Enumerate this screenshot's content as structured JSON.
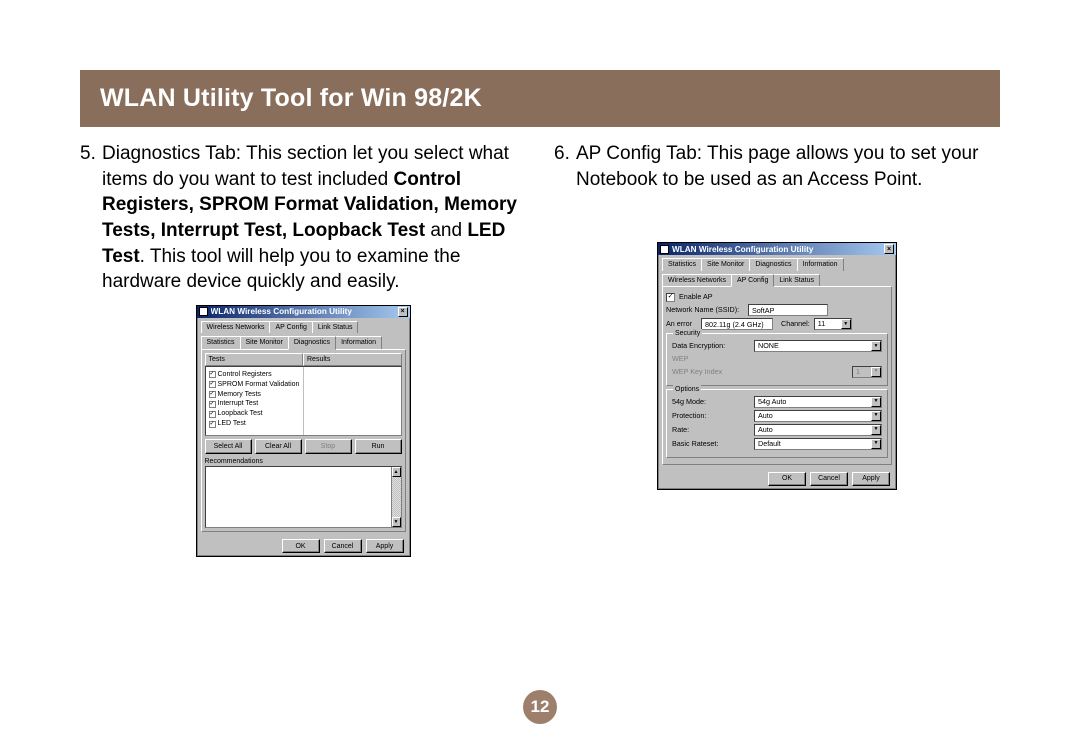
{
  "banner_title": "WLAN Utility Tool for Win 98/2K",
  "left": {
    "num": "5.",
    "p1": "Diagnostics Tab: This section let you select what items do you want to test included ",
    "bold": "Control Registers, SPROM Format Validation, Memory Tests, Interrupt Test, Loopback Test ",
    "mid": "and ",
    "bold2": "LED Test",
    "p2": ". This tool will help you to examine the hardware device quickly and easily."
  },
  "right": {
    "num": "6.",
    "p1": "AP Config Tab: This page allows you to set your Notebook to be used as an Access Point."
  },
  "page_number": "12",
  "winA": {
    "title": "WLAN Wireless Configuration Utility",
    "tabs_row1": [
      "Wireless Networks",
      "AP Config",
      "Link Status"
    ],
    "tabs_row2": [
      "Statistics",
      "Site Monitor",
      "Diagnostics",
      "Information"
    ],
    "active_tab": "Diagnostics",
    "col_tests": "Tests",
    "col_results": "Results",
    "tests": [
      "Control Registers",
      "SPROM Format Validation",
      "Memory Tests",
      "Interrupt Test",
      "Loopback Test",
      "LED  Test"
    ],
    "btns": [
      "Select All",
      "Clear All",
      "Stop",
      "Run"
    ],
    "rec_label": "Recommendations",
    "dlg_btns": [
      "OK",
      "Cancel",
      "Apply"
    ]
  },
  "winB": {
    "title": "WLAN Wireless Configuration Utility",
    "tabs_row1": [
      "Statistics",
      "Site Monitor",
      "Diagnostics",
      "Information"
    ],
    "tabs_row2": [
      "Wireless Networks",
      "AP Config",
      "Link Status"
    ],
    "active_tab": "AP Config",
    "enable_ap": "Enable AP",
    "ssid_label": "Network Name (SSID):",
    "ssid_value": "SoftAP",
    "anerror_label": "An error",
    "anerror_value": "802.11g (2.4 GHz)",
    "channel_label": "Channel:",
    "channel_value": "11",
    "security_legend": "Security",
    "enc_label": "Data Encryption:",
    "enc_value": "NONE",
    "wep_label": "WEP",
    "wep_key_label": "WEP Key Index",
    "wep_key_value": "1",
    "options_legend": "Options",
    "g54_label": "54g Mode:",
    "g54_value": "54g Auto",
    "prot_label": "Protection:",
    "prot_value": "Auto",
    "rate_label": "Rate:",
    "rate_value": "Auto",
    "basic_label": "Basic Rateset:",
    "basic_value": "Default",
    "dlg_btns": [
      "OK",
      "Cancel",
      "Apply"
    ]
  }
}
